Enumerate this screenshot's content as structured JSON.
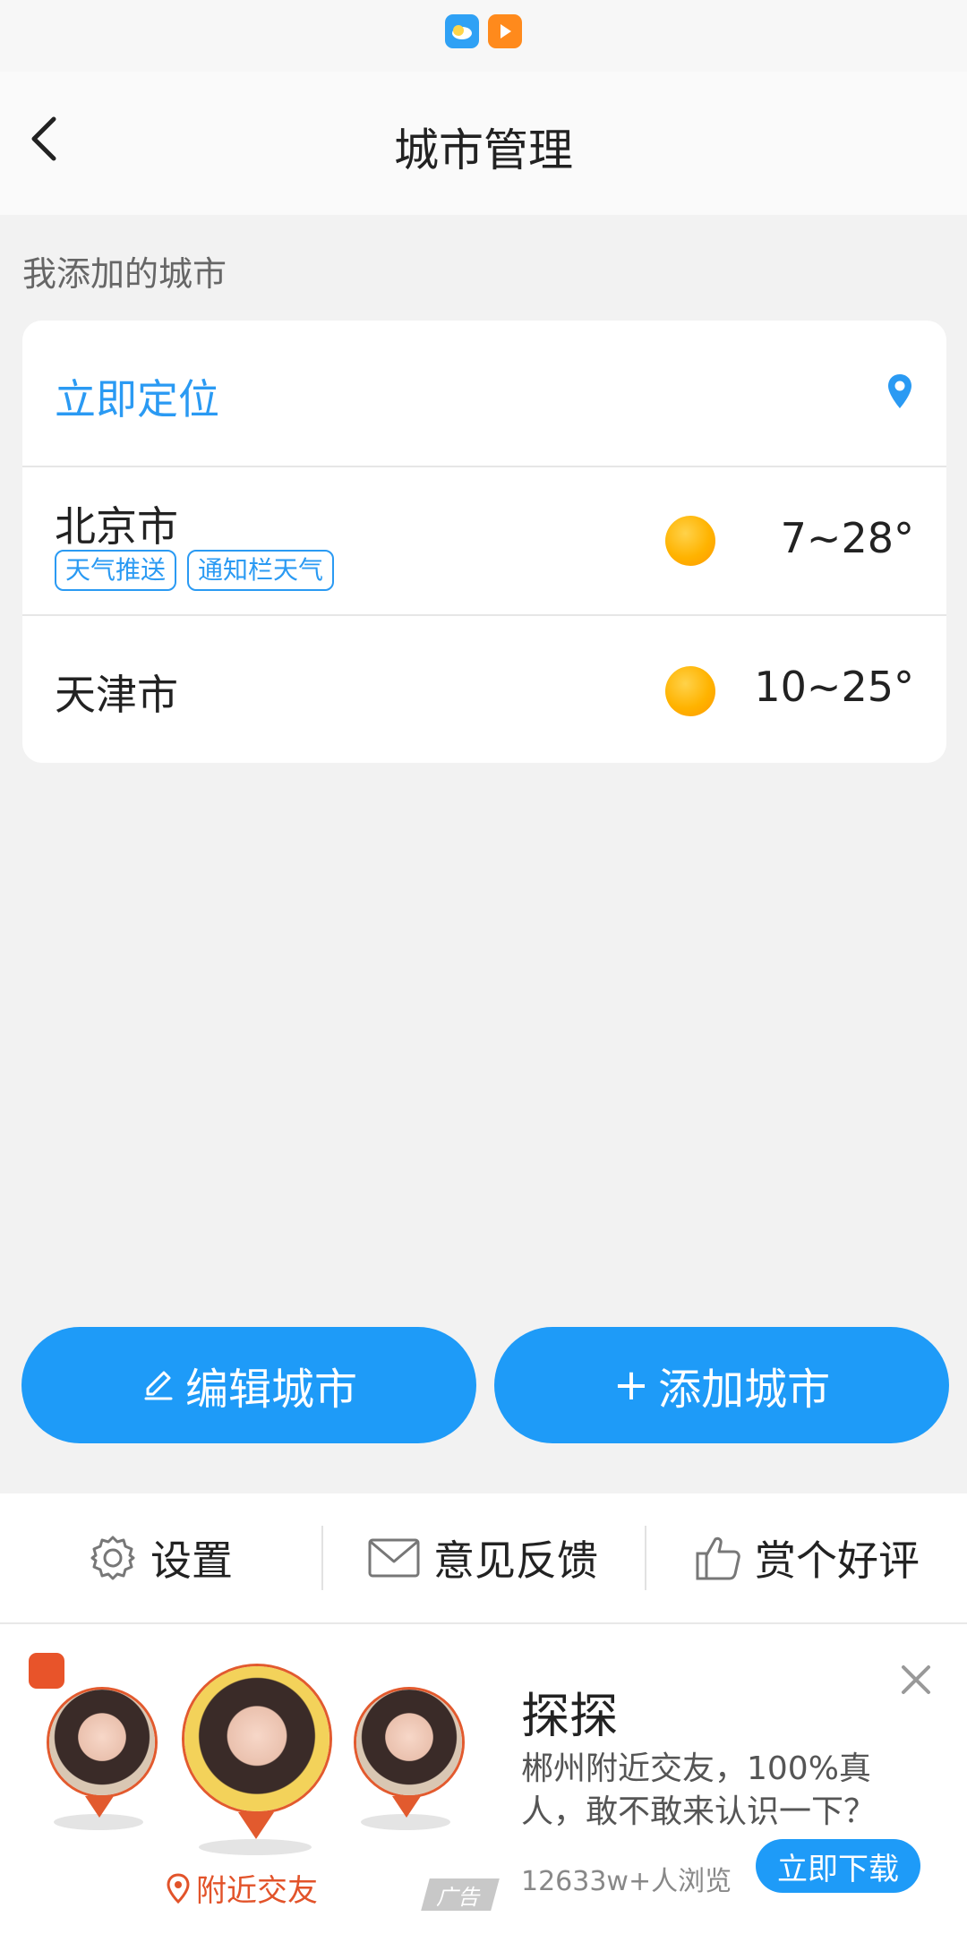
{
  "status_bar": {
    "icons": [
      "weather-app-icon",
      "video-app-icon"
    ]
  },
  "header": {
    "title": "城市管理",
    "back_icon": "chevron-left-icon"
  },
  "section_label": "我添加的城市",
  "locate": {
    "label": "立即定位",
    "icon": "location-pin-icon"
  },
  "cities": [
    {
      "name": "北京市",
      "tags": [
        "天气推送",
        "通知栏天气"
      ],
      "weather_icon": "sunny-icon",
      "temp": "7~28°"
    },
    {
      "name": "天津市",
      "tags": [],
      "weather_icon": "sunny-icon",
      "temp": "10~25°"
    }
  ],
  "actions": {
    "edit_label": "编辑城市",
    "add_label": "添加城市",
    "add_prefix": "+"
  },
  "bottom_menu": [
    {
      "label": "设置",
      "icon": "gear-icon"
    },
    {
      "label": "意见反馈",
      "icon": "mail-icon"
    },
    {
      "label": "赏个好评",
      "icon": "thumbs-up-icon"
    }
  ],
  "ad": {
    "title": "探探",
    "description": "郴州附近交友，100%真人，敢不敢来认识一下？",
    "views": "12633w+人浏览",
    "cta": "立即下载",
    "nearby_label": "附近交友",
    "badge": "广告"
  },
  "colors": {
    "accent": "#1e9bf8",
    "link": "#2a9af3",
    "ad_accent": "#e2532a"
  }
}
